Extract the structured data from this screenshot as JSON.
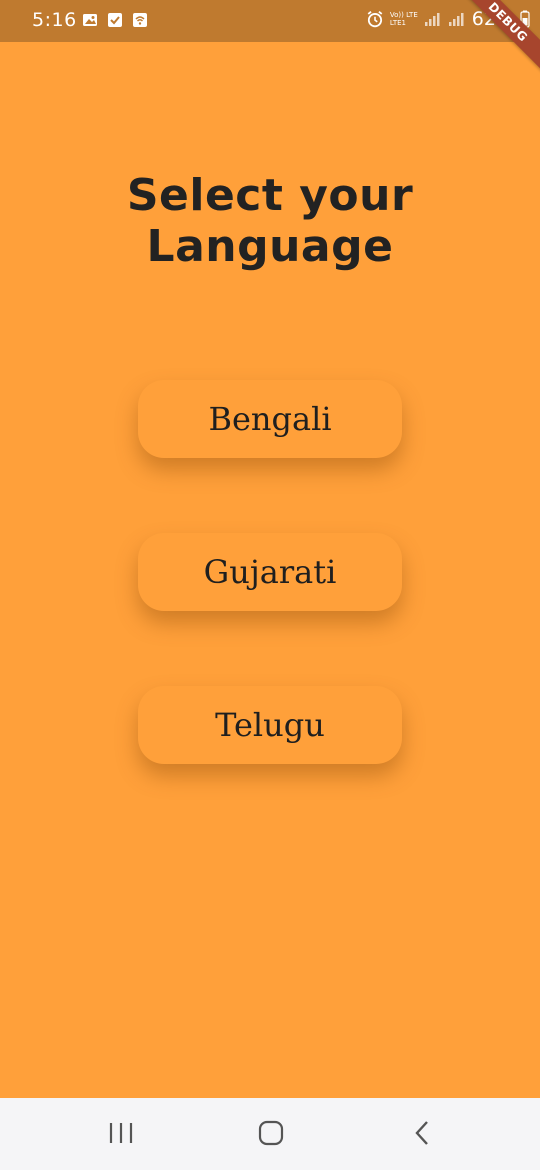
{
  "status_bar": {
    "time": "5:16",
    "lte_top": "Vo)) LTE",
    "lte_bottom": "LTE1",
    "battery": "62%",
    "icons_left": [
      "gallery-icon",
      "check-box-icon",
      "wifi-call-icon"
    ],
    "icons_right": [
      "alarm-icon",
      "volte-icon",
      "signal-icon",
      "signal-icon",
      "battery-icon"
    ]
  },
  "debug_banner": "DEBUG",
  "page": {
    "title": "Select your Language"
  },
  "languages": [
    {
      "label": "Bengali"
    },
    {
      "label": "Gujarati"
    },
    {
      "label": "Telugu"
    }
  ],
  "nav_bar": {
    "icons": [
      "recent-apps-icon",
      "home-icon",
      "back-icon"
    ]
  },
  "colors": {
    "background": "#FFA03A",
    "status_bar": "#BF7A2F",
    "title_text": "#222222",
    "debug_ribbon": "#A7452D",
    "nav_bar": "#F5F5F7"
  }
}
